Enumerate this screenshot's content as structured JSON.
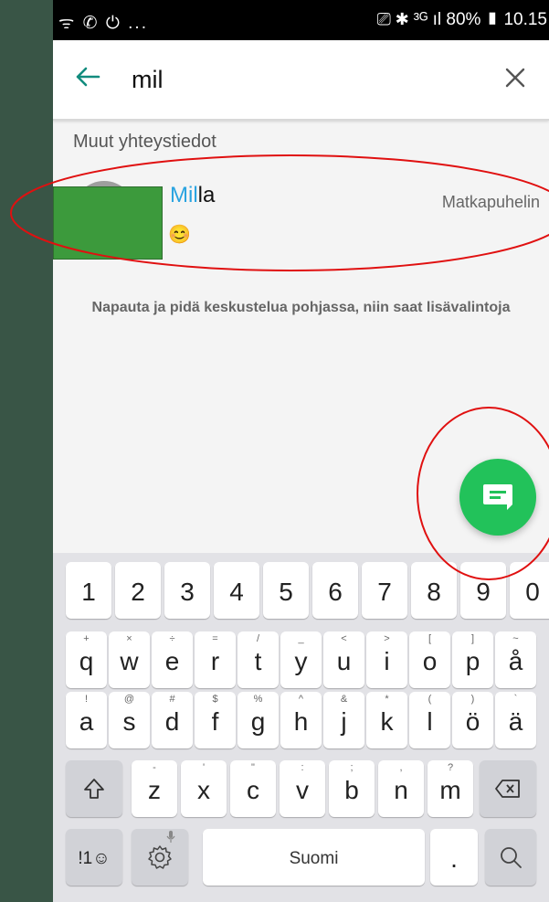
{
  "status_bar": {
    "left_icons": "ᯤ ✆ ⏻ ...",
    "right_icons": "⎚ ✱ ³ᴳ ıl",
    "battery": "80%",
    "time": "10.15"
  },
  "search": {
    "query": "mil"
  },
  "section_header": "Muut yhteystiedot",
  "contact": {
    "name_highlight": "Mil",
    "name_rest": "la",
    "type": "Matkapuhelin",
    "status_emoji": "😊"
  },
  "hint": "Napauta ja pidä keskustelua pohjassa, niin saat lisävalintoja",
  "keyboard": {
    "row1": [
      {
        "main": "1",
        "sub": ""
      },
      {
        "main": "2",
        "sub": ""
      },
      {
        "main": "3",
        "sub": ""
      },
      {
        "main": "4",
        "sub": ""
      },
      {
        "main": "5",
        "sub": ""
      },
      {
        "main": "6",
        "sub": ""
      },
      {
        "main": "7",
        "sub": ""
      },
      {
        "main": "8",
        "sub": ""
      },
      {
        "main": "9",
        "sub": ""
      },
      {
        "main": "0",
        "sub": ""
      }
    ],
    "row2": [
      {
        "main": "q",
        "sub": "+"
      },
      {
        "main": "w",
        "sub": "×"
      },
      {
        "main": "e",
        "sub": "÷"
      },
      {
        "main": "r",
        "sub": "="
      },
      {
        "main": "t",
        "sub": "/"
      },
      {
        "main": "y",
        "sub": "_"
      },
      {
        "main": "u",
        "sub": "<"
      },
      {
        "main": "i",
        "sub": ">"
      },
      {
        "main": "o",
        "sub": "["
      },
      {
        "main": "p",
        "sub": "]"
      },
      {
        "main": "å",
        "sub": "~"
      }
    ],
    "row3": [
      {
        "main": "a",
        "sub": "!"
      },
      {
        "main": "s",
        "sub": "@"
      },
      {
        "main": "d",
        "sub": "#"
      },
      {
        "main": "f",
        "sub": "$"
      },
      {
        "main": "g",
        "sub": "%"
      },
      {
        "main": "h",
        "sub": "^"
      },
      {
        "main": "j",
        "sub": "&"
      },
      {
        "main": "k",
        "sub": "*"
      },
      {
        "main": "l",
        "sub": "("
      },
      {
        "main": "ö",
        "sub": ")"
      },
      {
        "main": "ä",
        "sub": "`"
      }
    ],
    "row4": [
      {
        "main": "z",
        "sub": "-"
      },
      {
        "main": "x",
        "sub": "'"
      },
      {
        "main": "c",
        "sub": "\""
      },
      {
        "main": "v",
        "sub": ":"
      },
      {
        "main": "b",
        "sub": ";"
      },
      {
        "main": "n",
        "sub": ","
      },
      {
        "main": "m",
        "sub": "?"
      }
    ],
    "symbols_label": "!1☺",
    "space_label": "Suomi",
    "period_label": "."
  },
  "colors": {
    "accent_green": "#22c25a",
    "highlight_blue": "#29a3e0",
    "annotation_red": "#e01010",
    "background": "#395546"
  }
}
